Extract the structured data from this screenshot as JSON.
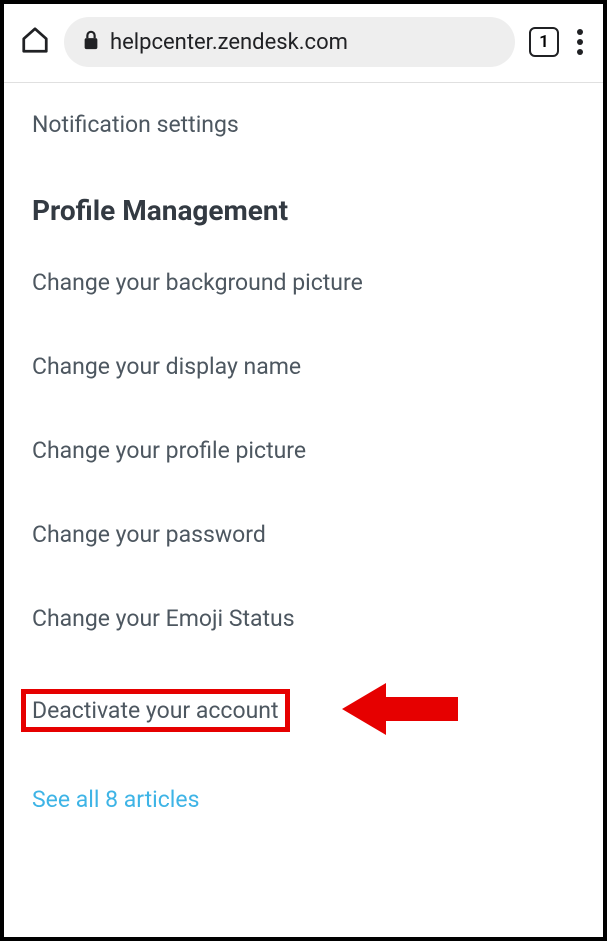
{
  "browser": {
    "url_host": "helpcenter.zendesk.com",
    "tab_count": "1"
  },
  "top_link": "Notification settings",
  "section_heading": "Profile Management",
  "articles": [
    "Change your background picture",
    "Change your display name",
    "Change your profile picture",
    "Change your password",
    "Change your Emoji Status",
    "Deactivate your account"
  ],
  "see_all_label": "See all 8 articles"
}
